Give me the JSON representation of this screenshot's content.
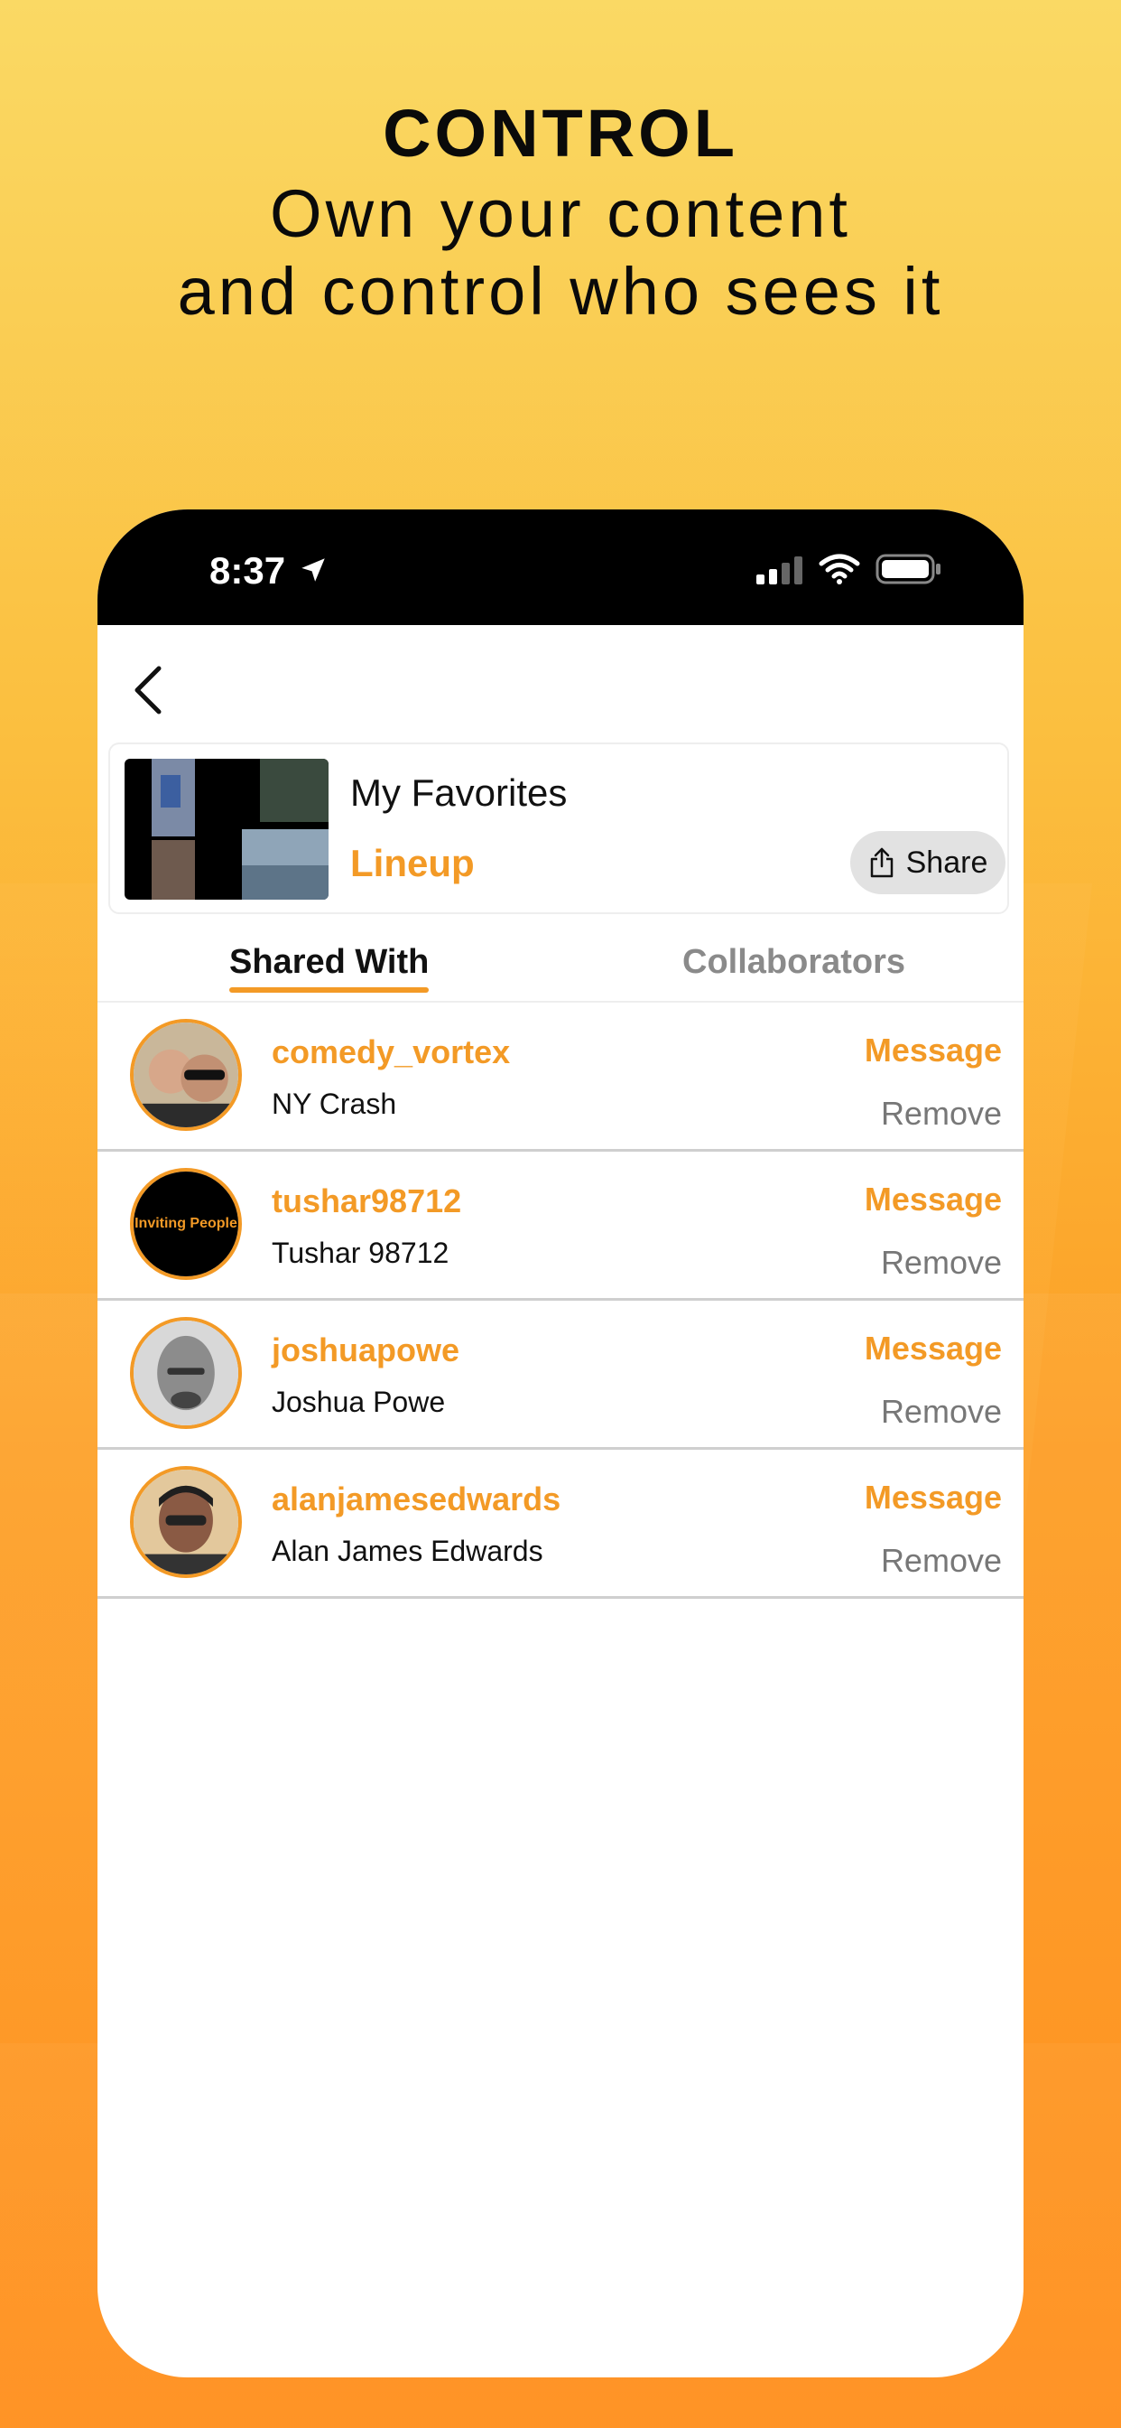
{
  "headline": {
    "title": "CONTROL",
    "line1": "Own your content",
    "line2": "and control who sees it"
  },
  "status_bar": {
    "time": "8:37"
  },
  "collection": {
    "title": "My Favorites",
    "type_label": "Lineup",
    "share_label": "Share"
  },
  "tabs": [
    {
      "label": "Shared With",
      "active": true
    },
    {
      "label": "Collaborators",
      "active": false
    }
  ],
  "members": [
    {
      "username": "comedy_vortex",
      "name": "NY Crash",
      "message_label": "Message",
      "remove_label": "Remove"
    },
    {
      "username": "tushar98712",
      "name": "Tushar 98712",
      "message_label": "Message",
      "remove_label": "Remove",
      "avatar_text": "Inviting People"
    },
    {
      "username": "joshuapowe",
      "name": "Joshua Powe",
      "message_label": "Message",
      "remove_label": "Remove"
    },
    {
      "username": "alanjamesedwards",
      "name": "Alan James Edwards",
      "message_label": "Message",
      "remove_label": "Remove"
    }
  ],
  "colors": {
    "accent": "#f39a26",
    "background_top": "#fad964",
    "background_bottom": "#ff8a12"
  }
}
